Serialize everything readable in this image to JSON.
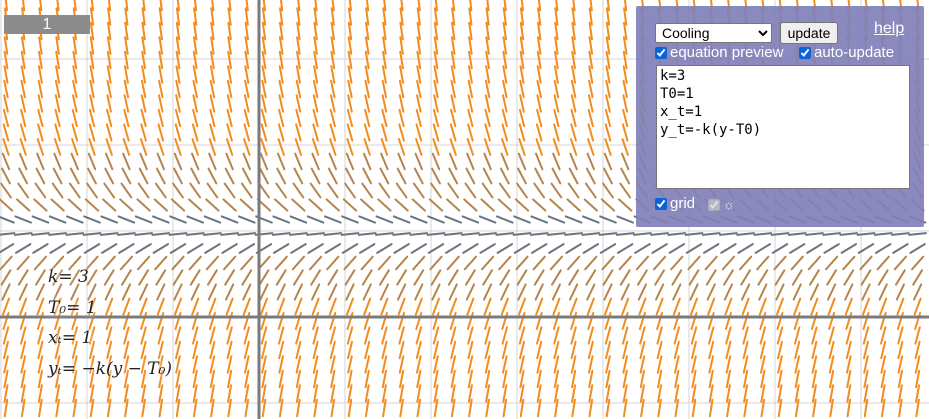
{
  "step_counter": "1",
  "panel": {
    "preset": {
      "selected": "Cooling",
      "options": [
        "Cooling"
      ]
    },
    "update_label": "update",
    "help_label": "help",
    "equation_preview_label": "equation preview",
    "auto_update_label": "auto-update",
    "code": "k=3\nT0=1\nx_t=1\ny_t=-k(y-T0)",
    "grid_label": "grid",
    "sun_icon_label": "☼"
  },
  "equations_preview": [
    {
      "lhs": "k",
      "rhs": " = 3"
    },
    {
      "lhs": "T₀",
      "rhs": " = 1"
    },
    {
      "lhs": "xₜ",
      "rhs": " = 1"
    },
    {
      "lhs": "yₜ",
      "rhs": " = −k(y − T₀)"
    }
  ],
  "colors": {
    "steep_slope": "#f28c1e",
    "medium_slope": "#b8844e",
    "shallow_slope": "#6d7480",
    "axis": "#7a7a7a",
    "grid": "#d4d4d4",
    "panel": "#8080b8"
  },
  "slope_field": {
    "k": 3,
    "T0": 1
  }
}
